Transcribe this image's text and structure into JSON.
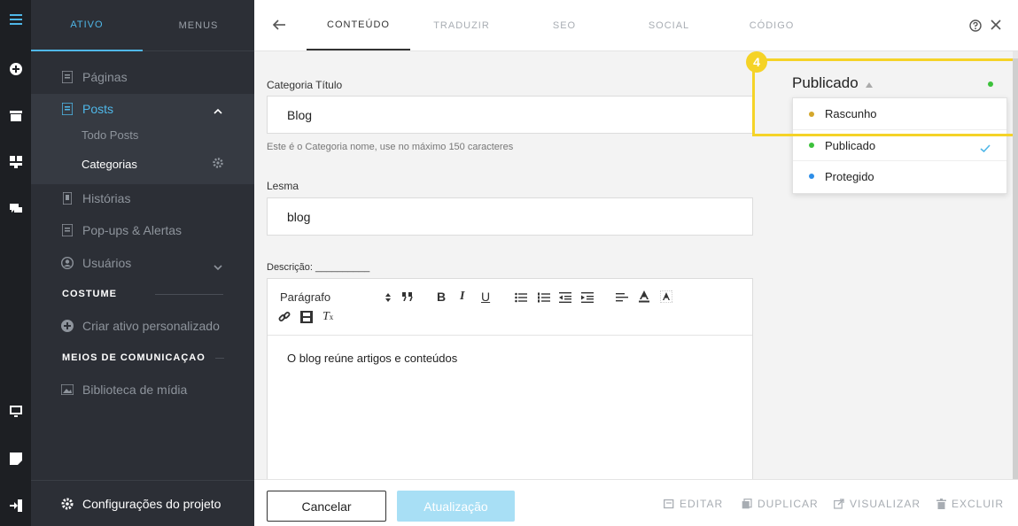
{
  "sidebar": {
    "tabs": [
      {
        "label": "ATIVO"
      },
      {
        "label": "MENUS"
      }
    ],
    "items": {
      "paginas": "Páginas",
      "posts": "Posts",
      "todo_posts": "Todo Posts",
      "categorias": "Categorias",
      "historias": "Histórias",
      "popups": "Pop-ups & Alertas",
      "usuarios": "Usuários"
    },
    "section_costume": "COSTUME",
    "criar": "Criar ativo personalizado",
    "section_meios": "MEIOS DE COMUNICAÇAO",
    "biblioteca": "Biblioteca de mídia",
    "footer": "Configurações do projeto"
  },
  "topbar": {
    "tabs": [
      {
        "label": "CONTEÚDO"
      },
      {
        "label": "TRADUZIR"
      },
      {
        "label": "SEO"
      },
      {
        "label": "SOCIAL"
      },
      {
        "label": "CÓDIGO"
      }
    ]
  },
  "form": {
    "categoria_label": "Categoria Título",
    "categoria_value": "Blog",
    "categoria_hint": "Este é o Categoria nome, use no máximo 150 caracteres",
    "lesma_label": "Lesma",
    "lesma_value": "blog",
    "descricao_label": "Descrição: __________",
    "editor_format": "Parágrafo",
    "editor_body": "O blog reúne artigos e conteúdos"
  },
  "status": {
    "current": "Publicado",
    "options": [
      {
        "label": "Rascunho",
        "color": "#d4a72c"
      },
      {
        "label": "Publicado",
        "color": "#3cc13b"
      },
      {
        "label": "Protegido",
        "color": "#2d8ee8"
      }
    ],
    "badge": "4",
    "indicator_color": "#3cc13b",
    "highlight_color": "#f5d327"
  },
  "footer": {
    "cancel": "Cancelar",
    "update": "Atualização",
    "editar": "EDITAR",
    "duplicar": "DUPLICAR",
    "visualizar": "VISUALIZAR",
    "excluir": "EXCLUIR"
  },
  "colors": {
    "accent": "#4fb7e8",
    "rail_bg": "#1d1f23",
    "sidebar_bg": "#2c2f36"
  }
}
